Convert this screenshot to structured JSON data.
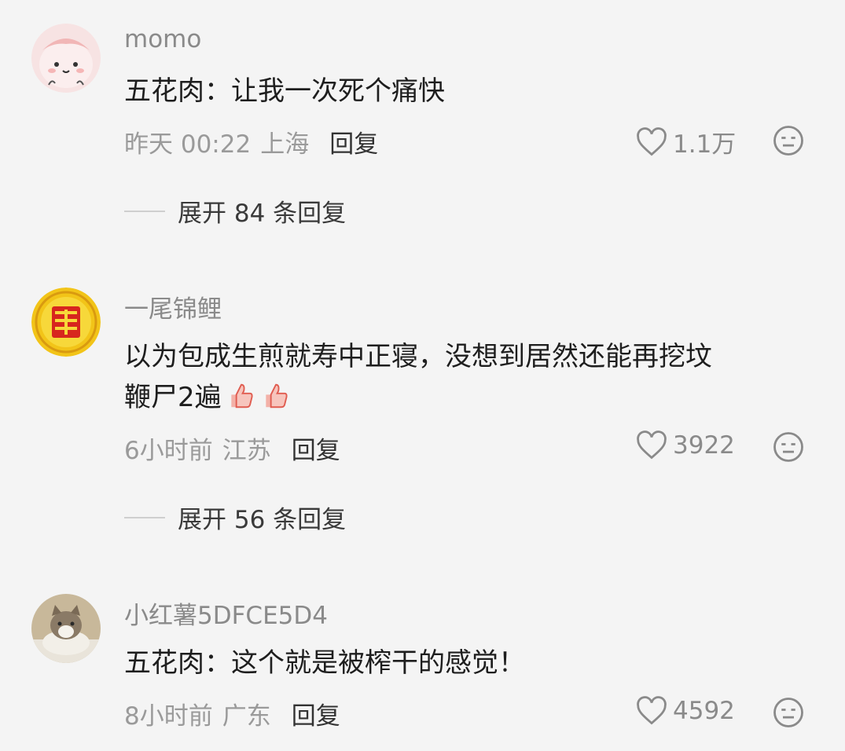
{
  "comments": [
    {
      "username": "momo",
      "text": "五花肉：让我一次死个痛快",
      "time": "昨天 00:22",
      "location": "上海",
      "reply_label": "回复",
      "likes": "1.1万",
      "expand_label": "展开 84 条回复"
    },
    {
      "username": "一尾锦鲤",
      "text_line1": "以为包成生煎就寿中正寝，没想到居然还能再挖坟",
      "text_line2": "鞭尸2遍",
      "time": "6小时前",
      "location": "江苏",
      "reply_label": "回复",
      "likes": "3922",
      "expand_label": "展开 56 条回复"
    },
    {
      "username": "小红薯5DFCE5D4",
      "text": "五花肉：这个就是被榨干的感觉！",
      "time": "8小时前",
      "location": "广东",
      "reply_label": "回复",
      "likes": "4592"
    }
  ],
  "icons": {
    "like": "heart-outline-icon",
    "dislike": "meh-face-icon",
    "thumb_emoji": "thumbs-up-emoji"
  },
  "colors": {
    "background": "#f4f4f4",
    "username": "#8a8a8a",
    "meta": "#9a9a9a"
  }
}
